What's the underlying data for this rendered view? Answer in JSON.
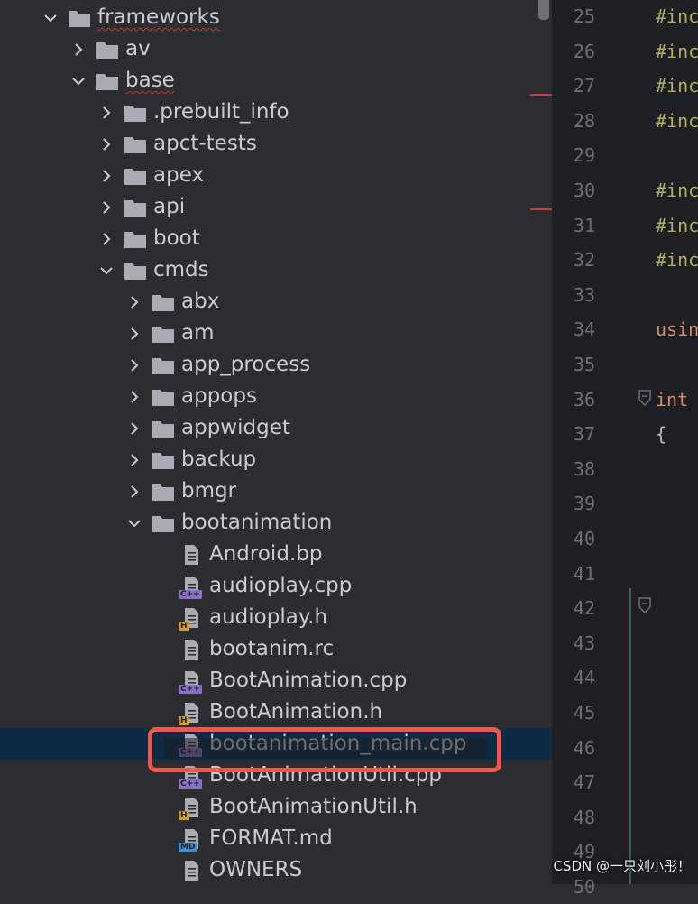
{
  "tree": {
    "rows": [
      {
        "label": "frameworks",
        "depth": 0,
        "expanded": true,
        "icon": "folder-icon",
        "underline": true
      },
      {
        "label": "av",
        "depth": 1,
        "expanded": false,
        "icon": "folder-icon"
      },
      {
        "label": "base",
        "depth": 1,
        "expanded": true,
        "icon": "folder-icon",
        "underline": true
      },
      {
        "label": ".prebuilt_info",
        "depth": 2,
        "expanded": false,
        "icon": "folder-icon"
      },
      {
        "label": "apct-tests",
        "depth": 2,
        "expanded": false,
        "icon": "folder-icon"
      },
      {
        "label": "apex",
        "depth": 2,
        "expanded": false,
        "icon": "folder-icon"
      },
      {
        "label": "api",
        "depth": 2,
        "expanded": false,
        "icon": "folder-icon"
      },
      {
        "label": "boot",
        "depth": 2,
        "expanded": false,
        "icon": "folder-icon"
      },
      {
        "label": "cmds",
        "depth": 2,
        "expanded": true,
        "icon": "folder-icon"
      },
      {
        "label": "abx",
        "depth": 3,
        "expanded": false,
        "icon": "folder-icon"
      },
      {
        "label": "am",
        "depth": 3,
        "expanded": false,
        "icon": "folder-icon"
      },
      {
        "label": "app_process",
        "depth": 3,
        "expanded": false,
        "icon": "folder-icon"
      },
      {
        "label": "appops",
        "depth": 3,
        "expanded": false,
        "icon": "folder-icon"
      },
      {
        "label": "appwidget",
        "depth": 3,
        "expanded": false,
        "icon": "folder-icon"
      },
      {
        "label": "backup",
        "depth": 3,
        "expanded": false,
        "icon": "folder-icon"
      },
      {
        "label": "bmgr",
        "depth": 3,
        "expanded": false,
        "icon": "folder-icon"
      },
      {
        "label": "bootanimation",
        "depth": 3,
        "expanded": true,
        "icon": "folder-icon"
      },
      {
        "label": "Android.bp",
        "depth": 4,
        "icon": "text-file-icon"
      },
      {
        "label": "audioplay.cpp",
        "depth": 4,
        "icon": "cpp-file-icon",
        "badge": "C++"
      },
      {
        "label": "audioplay.h",
        "depth": 4,
        "icon": "header-file-icon",
        "badge": "H"
      },
      {
        "label": "bootanim.rc",
        "depth": 4,
        "icon": "text-file-icon"
      },
      {
        "label": "BootAnimation.cpp",
        "depth": 4,
        "icon": "cpp-file-icon",
        "badge": "C++"
      },
      {
        "label": "BootAnimation.h",
        "depth": 4,
        "icon": "header-file-icon",
        "badge": "H"
      },
      {
        "label": "bootanimation_main.cpp",
        "depth": 4,
        "icon": "cpp-file-icon",
        "badge": "C++",
        "selected": true
      },
      {
        "label": "BootAnimationUtil.cpp",
        "depth": 4,
        "icon": "cpp-file-icon",
        "badge": "C++"
      },
      {
        "label": "BootAnimationUtil.h",
        "depth": 4,
        "icon": "header-file-icon",
        "badge": "H"
      },
      {
        "label": "FORMAT.md",
        "depth": 4,
        "icon": "markdown-file-icon",
        "badge": "MD"
      },
      {
        "label": "OWNERS",
        "depth": 4,
        "icon": "text-file-icon"
      }
    ]
  },
  "editor": {
    "lines": [
      {
        "num": "25",
        "code": "#inc",
        "kind": "pp"
      },
      {
        "num": "26",
        "code": "#inc",
        "kind": "pp"
      },
      {
        "num": "27",
        "code": "#inc",
        "kind": "pp"
      },
      {
        "num": "28",
        "code": "#inc",
        "kind": "pp"
      },
      {
        "num": "29",
        "code": "",
        "kind": "plain"
      },
      {
        "num": "30",
        "code": "#inc",
        "kind": "pp"
      },
      {
        "num": "31",
        "code": "#inc",
        "kind": "pp"
      },
      {
        "num": "32",
        "code": "#inc",
        "kind": "pp"
      },
      {
        "num": "33",
        "code": "",
        "kind": "plain"
      },
      {
        "num": "34",
        "code": "usin",
        "kind": "kw"
      },
      {
        "num": "35",
        "code": "",
        "kind": "plain"
      },
      {
        "num": "36",
        "code": "int",
        "kind": "kw"
      },
      {
        "num": "37",
        "code": "{",
        "kind": "plain"
      },
      {
        "num": "38",
        "code": "",
        "kind": "plain"
      },
      {
        "num": "39",
        "code": "",
        "kind": "plain"
      },
      {
        "num": "40",
        "code": "",
        "kind": "plain"
      },
      {
        "num": "41",
        "code": "",
        "kind": "plain"
      },
      {
        "num": "42",
        "code": "",
        "kind": "plain"
      },
      {
        "num": "43",
        "code": "",
        "kind": "plain"
      },
      {
        "num": "44",
        "code": "",
        "kind": "plain"
      },
      {
        "num": "45",
        "code": "",
        "kind": "plain"
      },
      {
        "num": "46",
        "code": "",
        "kind": "plain"
      },
      {
        "num": "47",
        "code": "",
        "kind": "plain"
      },
      {
        "num": "48",
        "code": "",
        "kind": "plain"
      },
      {
        "num": "49",
        "code": "",
        "kind": "plain"
      },
      {
        "num": "50",
        "code": "",
        "kind": "plain"
      }
    ]
  },
  "colors": {
    "selection": "#0f2a44",
    "highlight_box": "#f0564f",
    "preprocessor": "#b3ae60",
    "keyword": "#cf8e6d"
  },
  "watermark": "CSDN @一只刘小彤！"
}
